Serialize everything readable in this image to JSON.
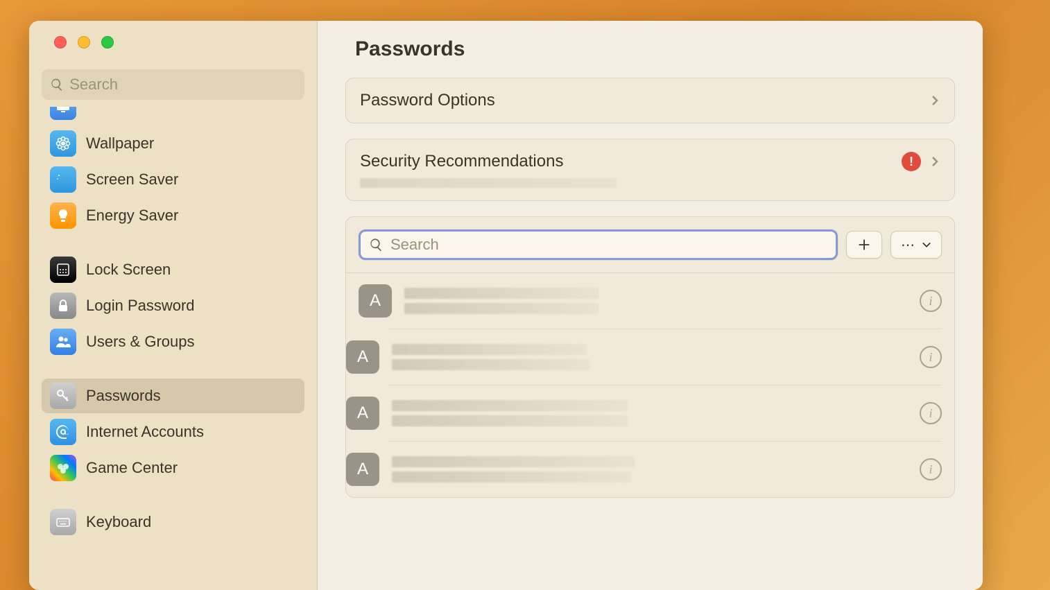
{
  "sidebar": {
    "search_placeholder": "Search",
    "items": [
      {
        "id": "displays-partial",
        "label": "",
        "icon_bg": "ic-blue",
        "icon": "display"
      },
      {
        "id": "wallpaper",
        "label": "Wallpaper",
        "icon_bg": "ic-bluesun",
        "icon": "flower"
      },
      {
        "id": "screen-saver",
        "label": "Screen Saver",
        "icon_bg": "ic-bluesun",
        "icon": "moon"
      },
      {
        "id": "energy-saver",
        "label": "Energy Saver",
        "icon_bg": "ic-orange",
        "icon": "bulb"
      },
      {
        "id": "gap"
      },
      {
        "id": "lock-screen",
        "label": "Lock Screen",
        "icon_bg": "ic-black",
        "icon": "lockscreen"
      },
      {
        "id": "login-password",
        "label": "Login Password",
        "icon_bg": "ic-gray",
        "icon": "lock"
      },
      {
        "id": "users-groups",
        "label": "Users & Groups",
        "icon_bg": "ic-bluep",
        "icon": "users"
      },
      {
        "id": "gap"
      },
      {
        "id": "passwords",
        "label": "Passwords",
        "icon_bg": "ic-graykey",
        "icon": "key",
        "selected": true
      },
      {
        "id": "internet-accounts",
        "label": "Internet Accounts",
        "icon_bg": "ic-blueia",
        "icon": "at"
      },
      {
        "id": "game-center",
        "label": "Game Center",
        "icon_bg": "ic-rainbow",
        "icon": "gamecenter"
      },
      {
        "id": "gap"
      },
      {
        "id": "keyboard",
        "label": "Keyboard",
        "icon_bg": "ic-graykb",
        "icon": "keyboard"
      }
    ]
  },
  "main": {
    "title": "Passwords",
    "password_options_label": "Password Options",
    "security_recommendations_label": "Security Recommendations",
    "security_recommendations_warning": true,
    "search_placeholder": "Search",
    "add_button_label": "+",
    "more_button_label": "⋯",
    "info_button_label": "i",
    "entries": [
      {
        "avatar_letter": "A"
      },
      {
        "avatar_letter": "A"
      },
      {
        "avatar_letter": "A"
      },
      {
        "avatar_letter": "A"
      }
    ],
    "redacted_widths": {
      "sec_sub": 370,
      "entry_lines": [
        [
          280,
          280
        ],
        [
          280,
          285
        ],
        [
          340,
          340
        ],
        [
          350,
          345
        ]
      ]
    }
  },
  "colors": {
    "accent_focus": "#8699d6",
    "warning": "#e14b3b"
  }
}
